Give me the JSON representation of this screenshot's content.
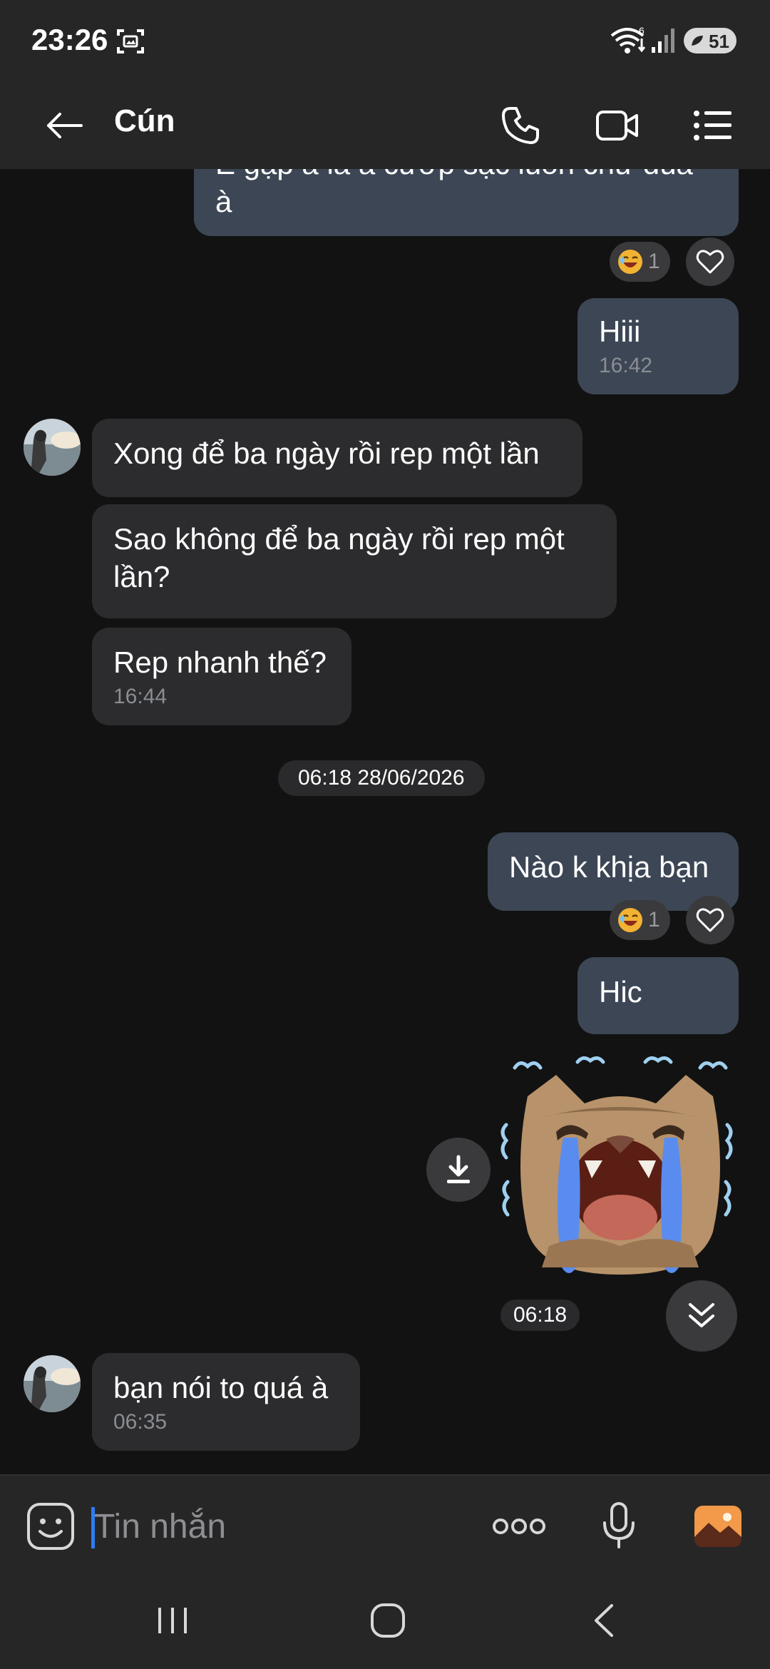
{
  "status_bar": {
    "time": "23:26",
    "battery_level": "51",
    "icons": [
      "screen-record-icon",
      "wifi-icon",
      "signal-icon",
      "battery-icon"
    ]
  },
  "header": {
    "contact_name": "Cún",
    "icons": [
      "back-arrow-icon",
      "phone-icon",
      "video-icon",
      "menu-list-icon"
    ]
  },
  "messages": [
    {
      "id": "m1",
      "direction": "out",
      "text": "E gặp a là a cướp sạc luôn chứ đùa à",
      "reaction_count": "1"
    },
    {
      "id": "m2",
      "direction": "out",
      "text": "Hiii",
      "time": "16:42"
    },
    {
      "id": "m3",
      "direction": "in",
      "text": "Xong để ba ngày rồi rep một lần"
    },
    {
      "id": "m4",
      "direction": "in",
      "text": "Sao không để ba ngày rồi rep một lần?"
    },
    {
      "id": "m5",
      "direction": "in",
      "text": "Rep nhanh thế?",
      "time": "16:44"
    },
    {
      "id": "m6",
      "direction": "out",
      "text": "Nào k khịa bạn",
      "reaction_count": "1"
    },
    {
      "id": "m7",
      "direction": "out",
      "text": "Hic"
    },
    {
      "id": "m8",
      "direction": "out",
      "type": "sticker",
      "sticker": "crying-cat-sticker",
      "time": "06:18"
    },
    {
      "id": "m9",
      "direction": "in",
      "text": "bạn nói to quá à",
      "time": "06:35"
    }
  ],
  "date_separator": "06:18 28/06/2026",
  "composer": {
    "placeholder": "Tin nhắn",
    "icons": [
      "emoji-icon",
      "more-options-icon",
      "microphone-icon",
      "image-icon"
    ]
  },
  "colors": {
    "background": "#121212",
    "bar_background": "#262626",
    "outgoing_bubble": "#3c4655",
    "incoming_bubble": "#2c2c2e",
    "caret": "#2f7bf6",
    "image_icon": "#f2994a"
  }
}
